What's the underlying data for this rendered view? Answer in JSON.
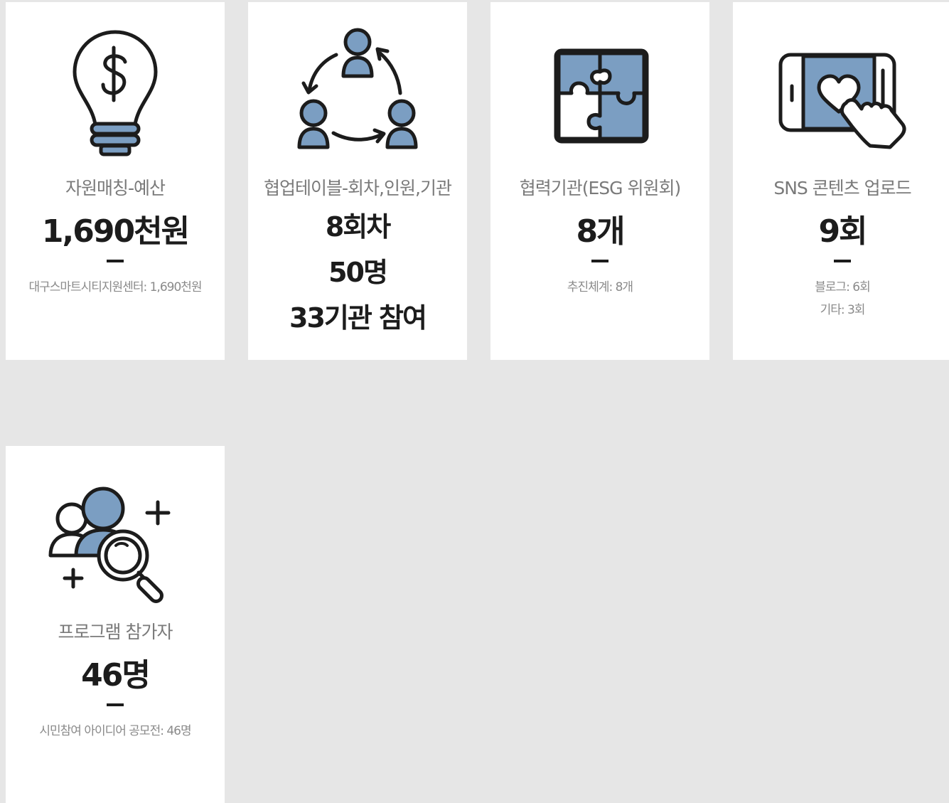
{
  "cards": [
    {
      "icon": "lightbulb-dollar-icon",
      "label": "자원매칭-예산",
      "value": "1,690천원",
      "details": [
        "대구스마트시티지원센터: 1,690천원"
      ]
    },
    {
      "icon": "collaboration-cycle-icon",
      "label": "협업테이블-회차,인원,기관",
      "values": [
        "8회차",
        "50명",
        "33기관 참여"
      ]
    },
    {
      "icon": "puzzle-icon",
      "label": "협력기관(ESG 위원회)",
      "value": "8개",
      "details": [
        "추진체계: 8개"
      ]
    },
    {
      "icon": "tablet-heart-icon",
      "label": "SNS 콘텐츠 업로드",
      "value": "9회",
      "details": [
        "블로그: 6회",
        "기타: 3회"
      ]
    },
    {
      "icon": "users-search-icon",
      "label": "프로그램 참가자",
      "value": "46명",
      "details": [
        "시민참여 아이디어 공모전: 46명"
      ]
    }
  ],
  "colors": {
    "background": "#e6e6e6",
    "card": "#ffffff",
    "accent": "#7b9ec2",
    "outline": "#1c1c1c",
    "label": "#7a7a7a",
    "detail": "#8a8a8a"
  }
}
